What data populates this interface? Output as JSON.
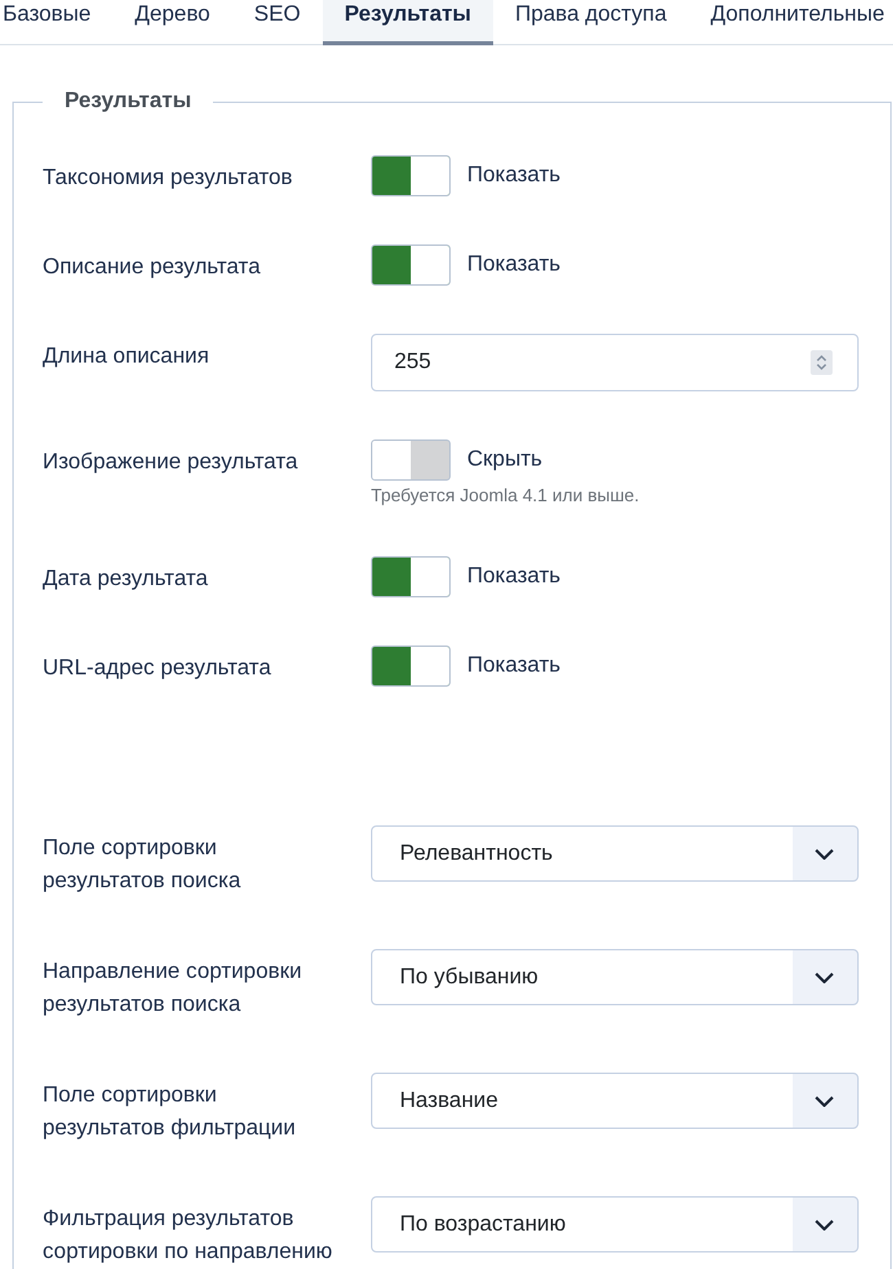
{
  "tabs": [
    {
      "label": "Базовые",
      "selected": false
    },
    {
      "label": "Дерево",
      "selected": false
    },
    {
      "label": "SEO",
      "selected": false
    },
    {
      "label": "Результаты",
      "selected": true
    },
    {
      "label": "Права доступа",
      "selected": false
    },
    {
      "label": "Дополнительные",
      "selected": false
    }
  ],
  "fieldset": {
    "legend": "Результаты",
    "fields": [
      {
        "kind": "toggle",
        "label": "Таксономия результатов",
        "on": true,
        "value_label": "Показать"
      },
      {
        "kind": "toggle",
        "label": "Описание результата",
        "on": true,
        "value_label": "Показать"
      },
      {
        "kind": "number",
        "label": "Длина описания",
        "value": "255"
      },
      {
        "kind": "toggle",
        "label": "Изображение результата",
        "on": false,
        "value_label": "Скрыть",
        "hint": "Требуется Joomla 4.1 или выше."
      },
      {
        "kind": "toggle",
        "label": "Дата результата",
        "on": true,
        "value_label": "Показать"
      },
      {
        "kind": "toggle",
        "label": "URL-адрес результата",
        "on": true,
        "value_label": "Показать"
      }
    ],
    "sort_fields": [
      {
        "kind": "select",
        "label": "Поле сортировки результатов поиска",
        "value": "Релевантность"
      },
      {
        "kind": "select",
        "label": "Направление сортировки результатов поиска",
        "value": "По убыванию"
      },
      {
        "kind": "select",
        "label": "Поле сортировки результатов фильтрации",
        "value": "Название"
      },
      {
        "kind": "select",
        "label": "Фильтрация результатов сортировки по направлению",
        "value": "По возрастанию"
      }
    ]
  }
}
